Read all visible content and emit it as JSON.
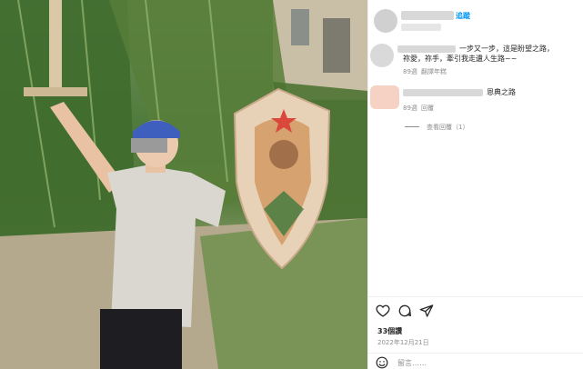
{
  "header": {
    "follow_label": "追蹤"
  },
  "comments": [
    {
      "text": "一步又一步，這是盼望之路，",
      "text2": "祢愛，祢手，牽引我走遺人生路~~",
      "time": "89週",
      "action": "翻譯年糕"
    },
    {
      "text": "恩典之路",
      "time": "89週",
      "action": "回覆",
      "replies": "查看回覆（1）"
    }
  ],
  "actions": {
    "like_icon": "heart-icon",
    "comment_icon": "comment-icon",
    "share_icon": "send-icon",
    "likes": "33個讚",
    "date": "2022年12月21日"
  },
  "compose": {
    "emoji_icon": "emoji-icon",
    "placeholder": "留言……"
  },
  "colors": {
    "accent": "#0095f6",
    "muted": "#8e8e8e",
    "shirt": "#d9d7d0",
    "bandana": "#3f5fbf"
  }
}
